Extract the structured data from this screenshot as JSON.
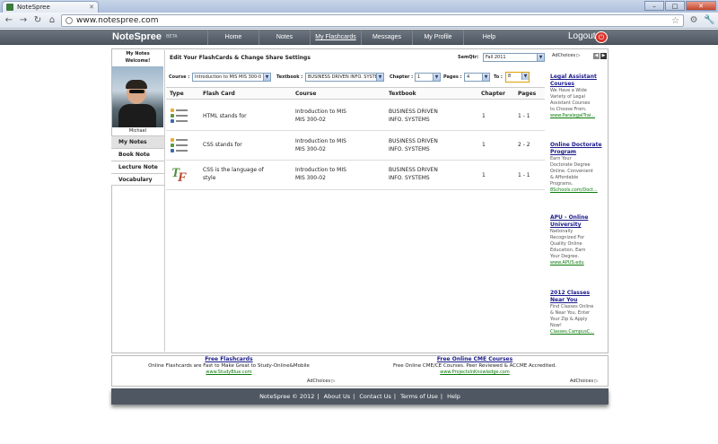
{
  "browser": {
    "tab_title": "NoteSpree",
    "url": "www.notespree.com"
  },
  "header": {
    "logo": "NoteSpree",
    "beta": "BETA",
    "nav": [
      "Home",
      "Notes",
      "My Flashcards",
      "Messages",
      "My Profile",
      "Help"
    ],
    "active_nav": "My Flashcards",
    "logout": "Logout"
  },
  "sidebar": {
    "title": "My Notes",
    "welcome": "Welcome!",
    "user_name": "Michael",
    "menu": [
      "My Notes",
      "Book Note",
      "Lecture Note",
      "Vocabulary"
    ]
  },
  "editor": {
    "title": "Edit Your FlashCards & Change Share Settings",
    "semqtr_label": "SemQtr:",
    "semqtr_value": "Fall 2011",
    "course_label": "Course :",
    "course_value": "Introduction to MIS MIS 300-0",
    "textbook_label": "Textbook :",
    "textbook_value": "BUSINESS DRIVEN INFO. SYSTEM",
    "chapter_label": "Chapter :",
    "chapter_value": "1",
    "pages_label": "Pages :",
    "pages_value": "4",
    "to_label": "To :",
    "to_value": "8"
  },
  "table": {
    "headers": [
      "Type",
      "Flash Card",
      "Course",
      "Textbook",
      "Chapter",
      "Pages"
    ],
    "rows": [
      {
        "type": "list",
        "card": "HTML stands for",
        "course1": "Introduction to MIS",
        "course2": "MIS 300-02",
        "book1": "BUSINESS DRIVEN",
        "book2": "INFO. SYSTEMS",
        "chapter": "1",
        "pages": "1 - 1"
      },
      {
        "type": "list",
        "card": "CSS stands for",
        "course1": "Introduction to MIS",
        "course2": "MIS 300-02",
        "book1": "BUSINESS DRIVEN",
        "book2": "INFO. SYSTEMS",
        "chapter": "1",
        "pages": "2 - 2"
      },
      {
        "type": "true-false",
        "card1": "CSS is the language of",
        "card2": "style",
        "course1": "Introduction to MIS",
        "course2": "MIS 300-02",
        "book1": "BUSINESS DRIVEN",
        "book2": "INFO. SYSTEMS",
        "chapter": "1",
        "pages": "1 - 1"
      }
    ]
  },
  "ads": {
    "adchoices": "AdChoices",
    "side": [
      {
        "title": [
          "Legal Assistant",
          "Courses"
        ],
        "text": [
          "We Have a Wide",
          "Variety of Legal",
          "Assistant Courses",
          "to Choose From."
        ],
        "url": "www.ParalegalTrai..."
      },
      {
        "title": [
          "Online Doctorate",
          "Program"
        ],
        "text": [
          "Earn Your",
          "Doctorate Degree",
          "Online. Convenient",
          "& Affordable",
          "Programs."
        ],
        "url": "8Schools.com/Doct..."
      },
      {
        "title": [
          "APU - Online",
          "University"
        ],
        "text": [
          "Nationally",
          "Recognized For",
          "Quality Online",
          "Education. Earn",
          "Your Degree."
        ],
        "url": "www.APUS.edu"
      },
      {
        "title": [
          "2012 Classes",
          "Near You"
        ],
        "text": [
          "Find Classes Online",
          "& Near You. Enter",
          "Your Zip & Apply",
          "Now!"
        ],
        "url": "Classes.CampusC..."
      }
    ],
    "bottom": [
      {
        "title": "Free Flashcards",
        "text": "Online Flashcards are Fast to Make Great to Study-Online&Mobile",
        "url": "www.StudyBlue.com"
      },
      {
        "title": "Free Online CME Courses",
        "text": "Free Online CME/CE Courses. Peer Reviewed & ACCME Accredited.",
        "url": "www.ProjectsInKnowledge.com"
      }
    ]
  },
  "footer": {
    "items": [
      "NoteSpree © 2012",
      "About Us",
      "Contact Us",
      "Terms of Use",
      "Help"
    ]
  }
}
